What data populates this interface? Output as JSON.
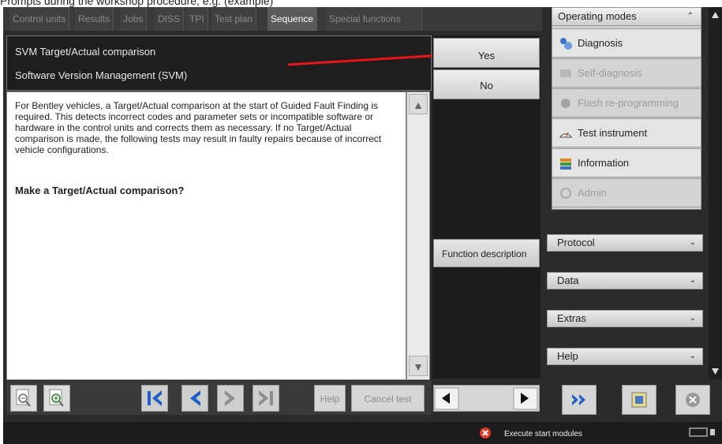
{
  "caption": "Prompts during the workshop procedure, e.g. (example)",
  "tabs": [
    "Control units",
    "Results",
    "Jobs",
    "DISS",
    "TPI",
    "Test plan",
    "Sequence",
    "Special functions"
  ],
  "active_tab": "Sequence",
  "header": {
    "line1": "SVM Target/Actual comparison",
    "line2": "Software Version Management (SVM)"
  },
  "body": {
    "paragraph": "For Bentley vehicles, a Target/Actual comparison at the start of Guided Fault Finding is required. This detects incorrect codes and parameter sets or incompatible software or hardware in the control units and corrects them as necessary. If no Target/Actual comparison is made, the following tests may result in faulty repairs because of incorrect vehicle configurations.",
    "question": "Make a Target/Actual comparison?"
  },
  "answers": {
    "yes": "Yes",
    "no": "No"
  },
  "function_description": "Function description",
  "toolbar": {
    "help": "Help",
    "cancel": "Cancel test"
  },
  "sidebar": {
    "title": "Operating modes",
    "modes": [
      {
        "label": "Diagnosis",
        "enabled": true
      },
      {
        "label": "Self-diagnosis",
        "enabled": false
      },
      {
        "label": "Flash re-programming",
        "enabled": false
      },
      {
        "label": "Test instrument",
        "enabled": true
      },
      {
        "label": "Information",
        "enabled": true
      },
      {
        "label": "Admin",
        "enabled": false
      }
    ],
    "sections": [
      "Protocol",
      "Data",
      "Extras",
      "Help"
    ]
  },
  "status": {
    "message": "Execute start modules"
  },
  "colors": {
    "arrow": "#e8151b",
    "panel_dark": "#1e1e1e",
    "active_tab": "#5a5a5a"
  }
}
